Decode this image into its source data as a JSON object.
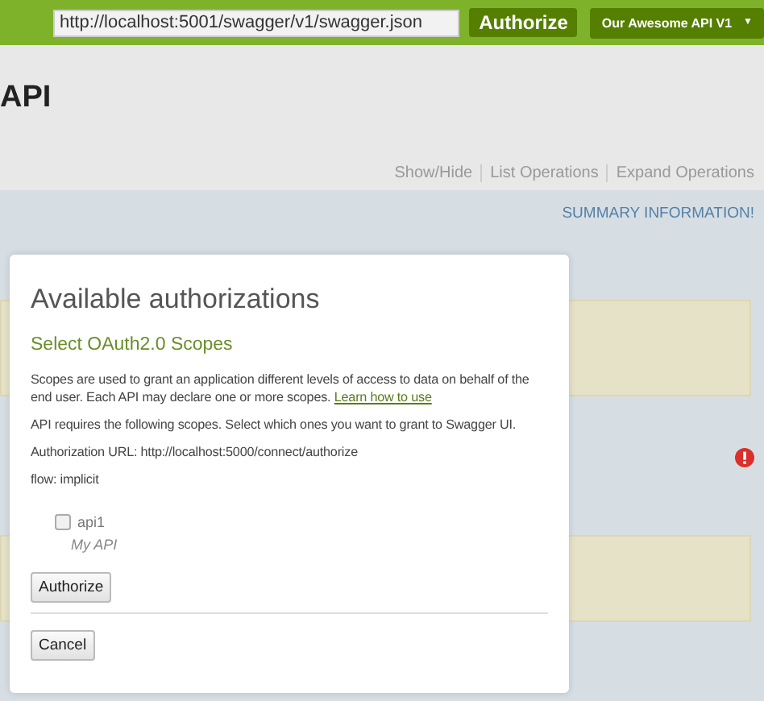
{
  "header": {
    "url": "http://localhost:5001/swagger/v1/swagger.json",
    "authorize_button": "Authorize",
    "api_select": "Our Awesome API V1",
    "select_caret": "▼"
  },
  "page": {
    "title": "API",
    "links": [
      "Show/Hide",
      "List Operations",
      "Expand Operations"
    ],
    "summary": "SUMMARY INFORMATION!"
  },
  "modal": {
    "title": "Available authorizations",
    "subtitle": "Select OAuth2.0 Scopes",
    "description": "Scopes are used to grant an application different levels of access to data on behalf of the end user. Each API may declare one or more scopes.",
    "learn_link": "Learn how to use",
    "requirement": "API requires the following scopes. Select which ones you want to grant to Swagger UI.",
    "auth_url": "Authorization URL: http://localhost:5000/connect/authorize",
    "flow": "flow: implicit",
    "scopes": [
      {
        "name": "api1",
        "description": "My API",
        "checked": false
      }
    ],
    "buttons": [
      "Authorize",
      "Cancel"
    ]
  }
}
